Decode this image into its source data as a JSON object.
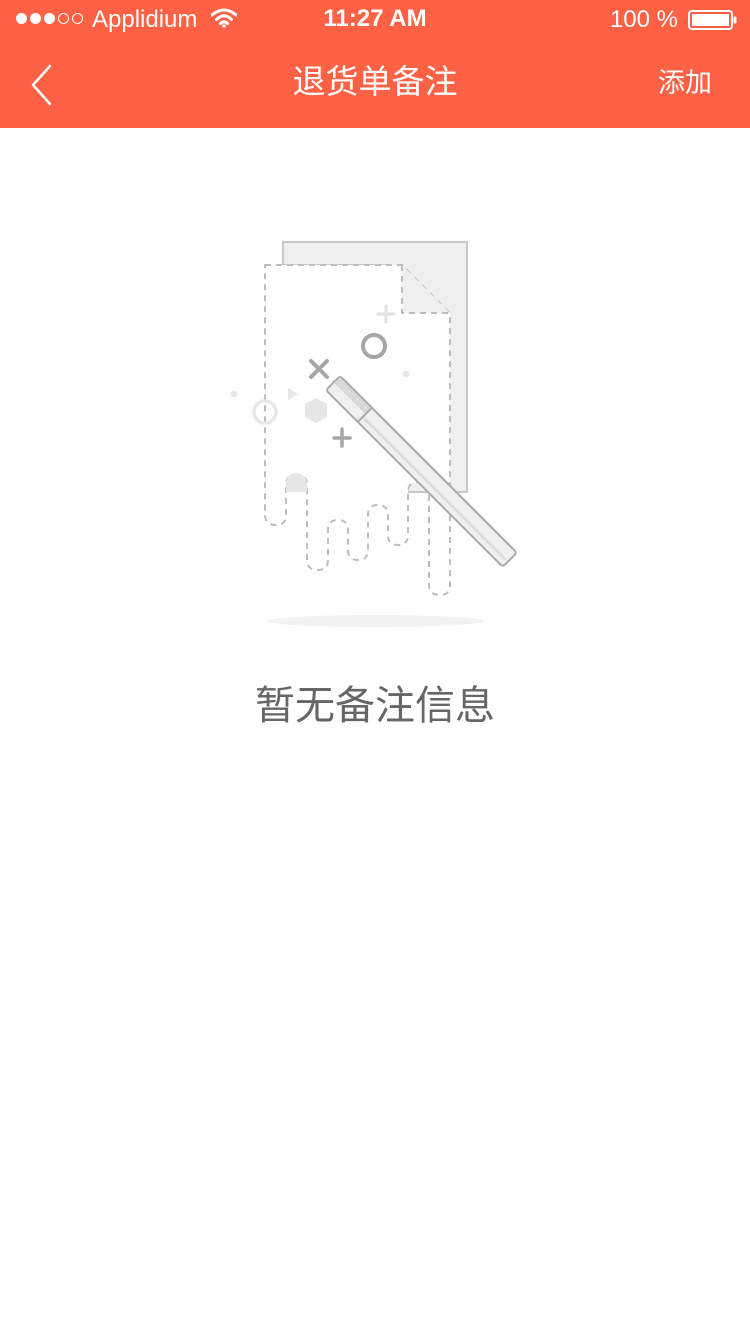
{
  "status_bar": {
    "signal_filled": 3,
    "signal_total": 5,
    "carrier": "Applidium",
    "time": "11:27 AM",
    "battery": "100 %"
  },
  "nav": {
    "back_icon": "chevron-left-icon",
    "title": "退货单备注",
    "add_label": "添加"
  },
  "empty_state": {
    "illustration": "empty-document-magic-wand",
    "message": "暂无备注信息"
  },
  "colors": {
    "header_bg": "#ff6145",
    "header_text": "#ffffff",
    "empty_text": "#666666",
    "page_bg": "#ffffff"
  }
}
